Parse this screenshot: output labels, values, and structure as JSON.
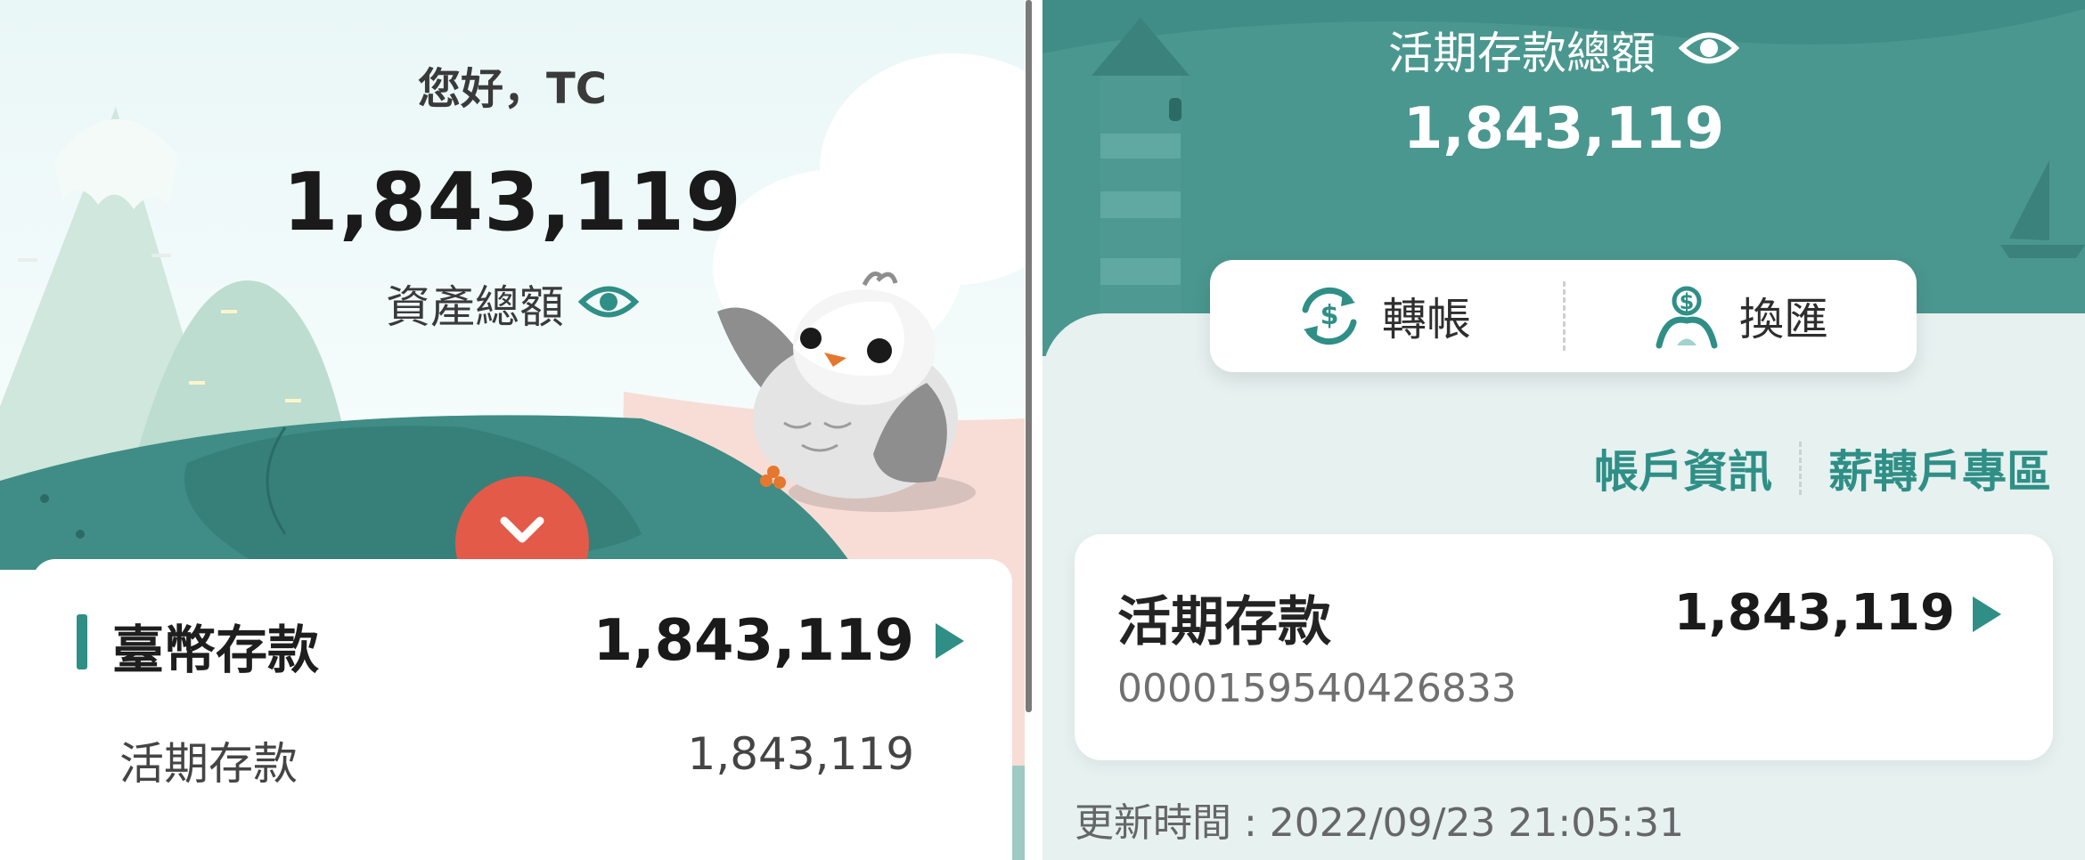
{
  "left": {
    "greeting": "您好，TC",
    "total": "1,843,119",
    "asset_label": "資產總額",
    "section": {
      "title": "臺幣存款",
      "amount": "1,843,119"
    },
    "row": {
      "label": "活期存款",
      "amount": "1,843,119"
    }
  },
  "right": {
    "title": "活期存款總額",
    "total": "1,843,119",
    "actions": [
      {
        "label": "轉帳",
        "icon": "transfer-icon"
      },
      {
        "label": "換匯",
        "icon": "exchange-icon"
      }
    ],
    "links": [
      "帳戶資訊",
      "薪轉戶專區"
    ],
    "account": {
      "title": "活期存款",
      "amount": "1,843,119",
      "number": "0000159540426833"
    },
    "updated": "更新時間 : 2022/09/23 21:05:31"
  },
  "colors": {
    "teal": "#2f8f86",
    "header": "#3f8d86",
    "accent_red": "#e45a49"
  }
}
